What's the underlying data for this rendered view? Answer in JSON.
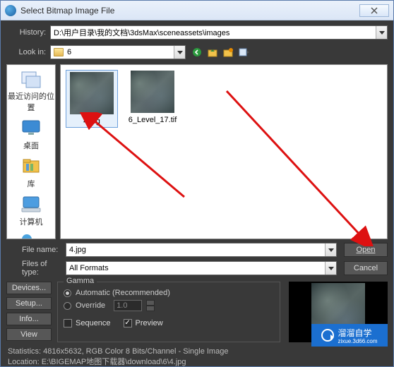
{
  "window": {
    "title": "Select Bitmap Image File"
  },
  "history": {
    "label": "History:",
    "value": "D:\\用户目录\\我的文档\\3dsMax\\sceneassets\\images"
  },
  "lookin": {
    "label": "Look in:",
    "value": "6"
  },
  "places": {
    "recent": {
      "label": "最近访问的位置"
    },
    "desktop": {
      "label": "桌面"
    },
    "library": {
      "label": "库"
    },
    "computer": {
      "label": "计算机"
    },
    "network": {
      "label": "网络"
    }
  },
  "files": {
    "items": [
      {
        "name": "4.jpg"
      },
      {
        "name": "6_Level_17.tif"
      }
    ]
  },
  "filename": {
    "label": "File name:",
    "value": "4.jpg"
  },
  "filetype": {
    "label": "Files of type:",
    "value": "All Formats"
  },
  "buttons": {
    "open": "Open",
    "cancel": "Cancel",
    "devices": "Devices...",
    "setup": "Setup...",
    "info": "Info...",
    "view": "View"
  },
  "gamma": {
    "legend": "Gamma",
    "auto": "Automatic (Recommended)",
    "override": "Override",
    "override_value": "1.0",
    "sequence": "Sequence",
    "preview": "Preview"
  },
  "stats": {
    "line1": "Statistics: 4816x5632, RGB Color 8 Bits/Channel - Single Image",
    "line2": "Location: E:\\BIGEMAP地图下载器\\download\\6\\4.jpg"
  },
  "logo": {
    "text": "溜溜自学",
    "sub": "zixue.3d66.com"
  }
}
